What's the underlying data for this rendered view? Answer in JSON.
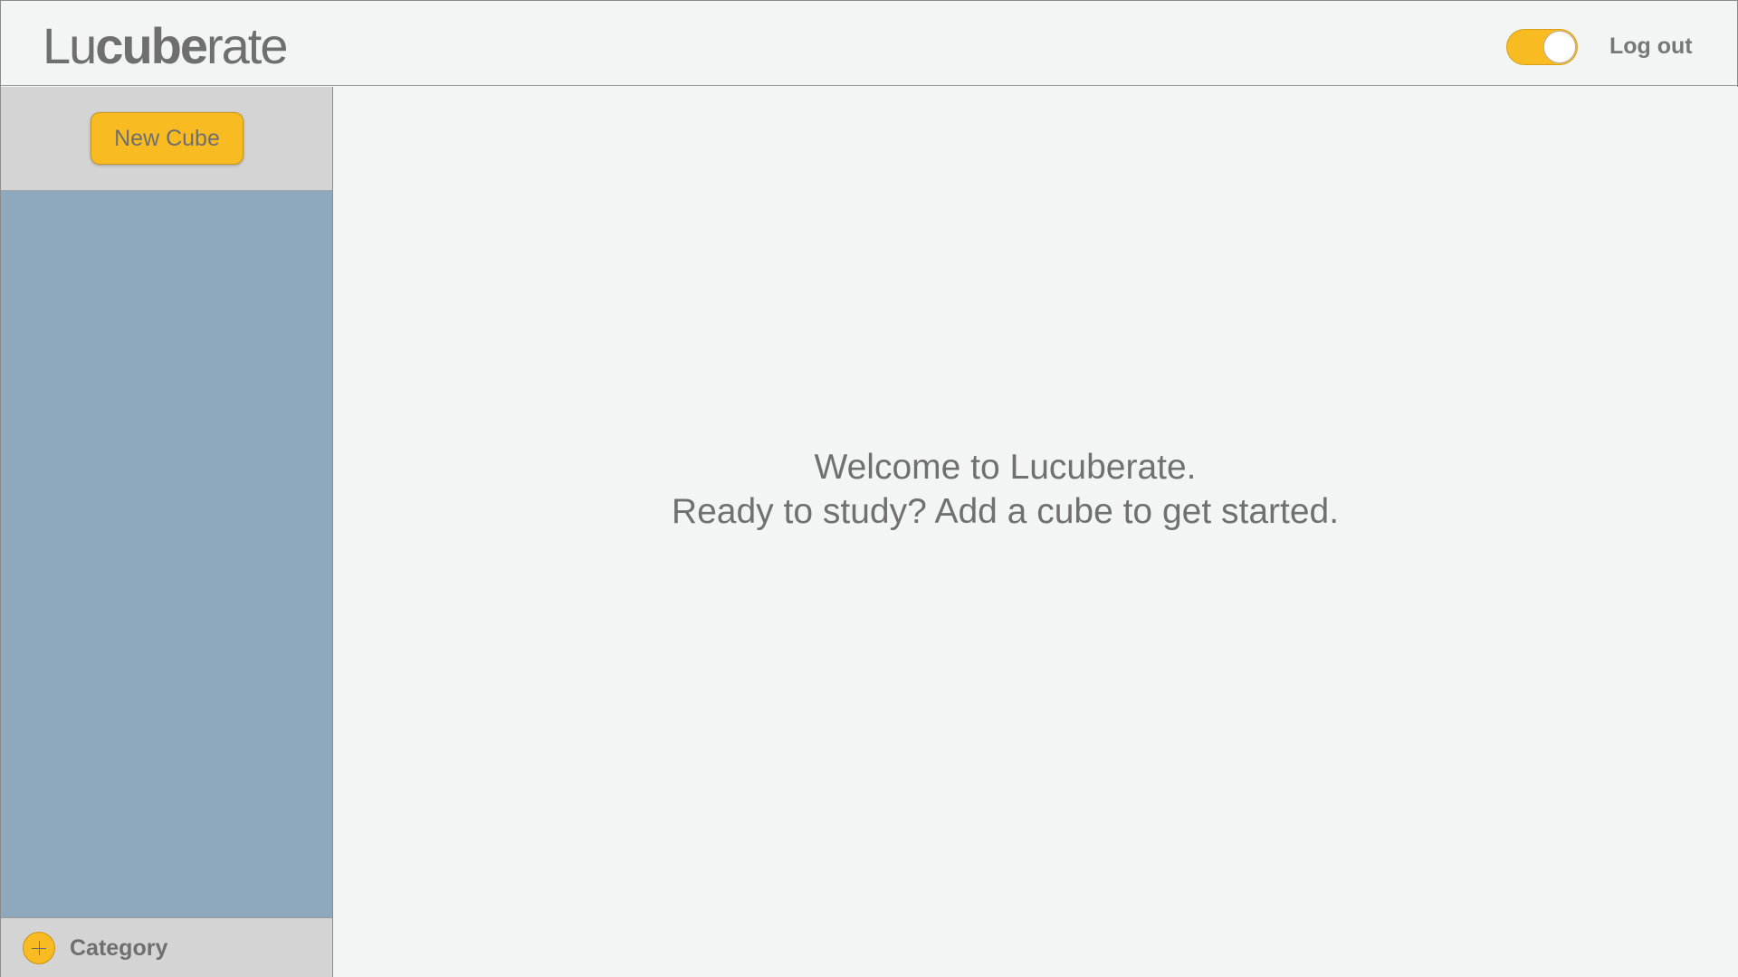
{
  "app": {
    "logo_prefix": "Lu",
    "logo_bold": "cube",
    "logo_suffix": "rate"
  },
  "header": {
    "toggle_state": "on",
    "logout_label": "Log out"
  },
  "sidebar": {
    "new_cube_label": "New Cube",
    "add_category_label": "Category",
    "items": []
  },
  "main": {
    "welcome_line1": "Welcome to Lucuberate.",
    "welcome_line2": "Ready to study? Add a cube to get started."
  },
  "colors": {
    "accent": "#f8bb22",
    "sidebar_list_bg": "#8ea8be",
    "panel_bg": "#d4d4d4",
    "page_bg": "#f3f5f4",
    "text": "#707070"
  }
}
